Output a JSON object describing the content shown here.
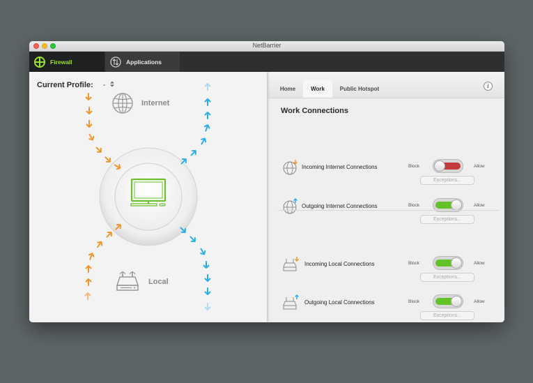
{
  "window": {
    "title": "NetBarrier"
  },
  "toolbar": {
    "firewall_label": "Firewall",
    "applications_label": "Applications"
  },
  "left": {
    "profile_label": "Current Profile:",
    "profile_value": "-",
    "internet_label": "Internet",
    "local_label": "Local"
  },
  "tabs": [
    {
      "label": "Home",
      "active": false
    },
    {
      "label": "Work",
      "active": true
    },
    {
      "label": "Public Hotspot",
      "active": false
    }
  ],
  "info_label": "i",
  "section_title": "Work Connections",
  "connections": [
    {
      "label": "Incoming Internet Connections",
      "icon": "globe-incoming-icon",
      "block": "Block",
      "allow": "Allow",
      "state": "blocked",
      "exceptions": "Exceptions..."
    },
    {
      "label": "Outgoing Internet Connections",
      "icon": "globe-outgoing-icon",
      "block": "Block",
      "allow": "Allow",
      "state": "allowed",
      "exceptions": "Exceptions..."
    },
    {
      "label": "Incoming Local Connections",
      "icon": "router-incoming-icon",
      "block": "Block",
      "allow": "Allow",
      "state": "allowed",
      "exceptions": "Exceptions..."
    },
    {
      "label": "Outgoing Local Connections",
      "icon": "router-outgoing-icon",
      "block": "Block",
      "allow": "Allow",
      "state": "allowed",
      "exceptions": "Exceptions..."
    }
  ],
  "colors": {
    "accent_green": "#9be22c",
    "toggle_on": "#62c228",
    "toggle_off": "#c33a3a",
    "arrow_orange": "#f0962a",
    "arrow_blue": "#2aaee8"
  }
}
